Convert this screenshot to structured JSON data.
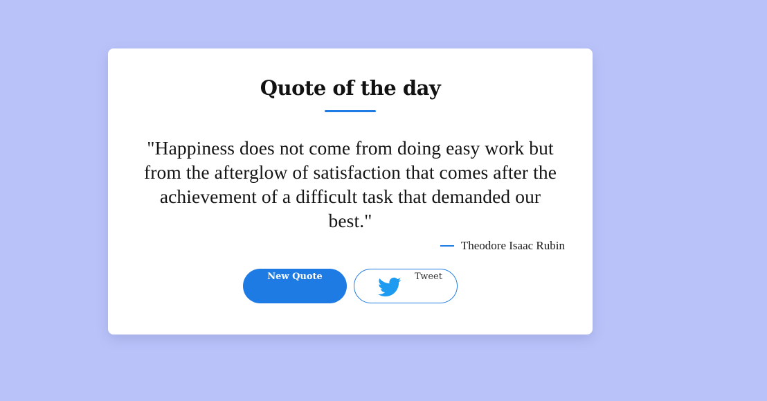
{
  "card": {
    "title": "Quote of the day",
    "quote": "\"Happiness does not come from doing easy work but from the afterglow of satisfaction that comes after the achievement of a difficult task that demanded our best.\"",
    "author": "Theodore Isaac Rubin"
  },
  "buttons": {
    "new_quote_label": "New Quote",
    "tweet_label": "Tweet",
    "tweet_icon": "twitter-bird-icon"
  },
  "colors": {
    "background": "#bac3f9",
    "accent": "#1e7be3",
    "twitter": "#1d9bf0",
    "card": "#ffffff"
  }
}
